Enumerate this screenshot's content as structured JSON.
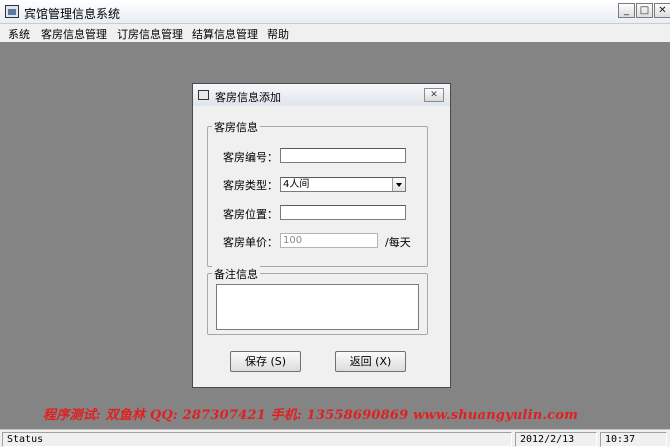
{
  "app": {
    "title": "宾馆管理信息系统"
  },
  "window_buttons": {
    "minimize": "_",
    "maximize": "□",
    "close": "✕"
  },
  "menu": [
    "系统",
    "客房信息管理",
    "订房信息管理",
    "结算信息管理",
    "帮助"
  ],
  "dialog": {
    "title": "客房信息添加",
    "close": "✕",
    "group_room": {
      "legend": "客房信息",
      "fields": {
        "room_no": {
          "label": "客房编号：",
          "value": ""
        },
        "room_type": {
          "label": "客房类型：",
          "value": "4人间"
        },
        "room_location": {
          "label": "客房位置：",
          "value": ""
        },
        "room_price": {
          "label": "客房单价：",
          "value": "100",
          "unit": "/每天"
        }
      }
    },
    "group_note": {
      "legend": "备注信息",
      "value": ""
    },
    "buttons": {
      "save": "保存 (S)",
      "back": "返回 (X)"
    }
  },
  "watermark": "程序测试: 双鱼林   QQ: 287307421   手机: 13558690869   www.shuangyulin.com",
  "statusbar": {
    "status": "Status",
    "date": "2012/2/13",
    "time": "10:37"
  },
  "colors": {
    "watermark": "#e02020",
    "mdi_background": "#848484"
  }
}
